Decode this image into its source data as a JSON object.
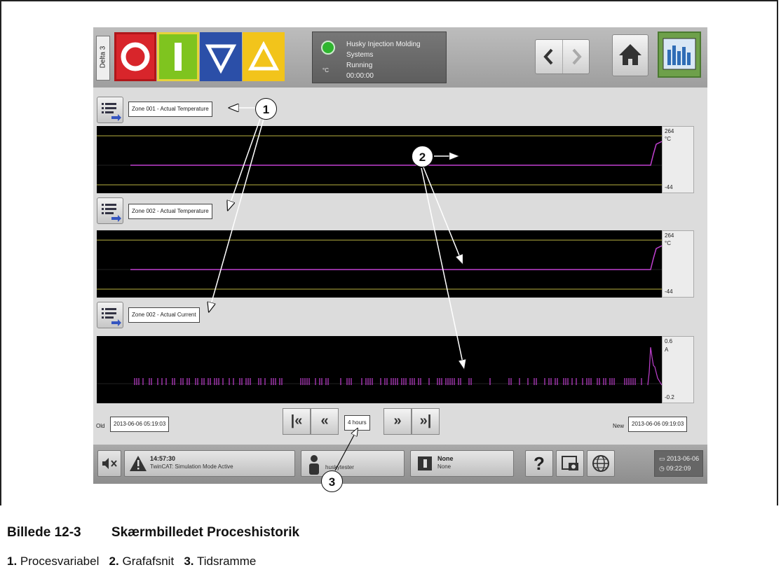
{
  "topbar": {
    "machine_label": "Delta 3",
    "status_title": "Husky Injection Molding Systems",
    "status_state": "Running",
    "status_time": "00:00:00",
    "status_unit": "°C",
    "status_light_color": "#2fb52f"
  },
  "rows": [
    {
      "label": "Zone 001 - Actual Temperature",
      "scale_max": "264",
      "scale_unit": "°C",
      "scale_min": "-44"
    },
    {
      "label": "Zone 002 - Actual Temperature",
      "scale_max": "264",
      "scale_unit": "°C",
      "scale_min": "-44"
    },
    {
      "label": "Zone 002 - Actual Current",
      "scale_max": "0.6",
      "scale_unit": "A",
      "scale_min": "-0.2"
    }
  ],
  "time_nav": {
    "old_label": "Old",
    "old_value": "2013-06-06 05:19:03",
    "range": "4 hours",
    "new_label": "New",
    "new_value": "2013-06-06 09:19:03"
  },
  "bottombar": {
    "alarm_time": "14:57:30",
    "alarm_text": "TwinCAT: Simulation Mode Active",
    "user": "huskytester",
    "mold_title": "None",
    "mold_sub": "None",
    "help": "?",
    "date": "2013-06-06",
    "time": "09:22:09"
  },
  "callouts": {
    "one": "1",
    "two": "2",
    "three": "3"
  },
  "caption": {
    "figure": "Billede 12-3",
    "title": "Skærmbilledet Proceshistorik"
  },
  "legend": [
    {
      "num": "1.",
      "text": "Procesvariabel"
    },
    {
      "num": "2.",
      "text": "Grafafsnit"
    },
    {
      "num": "3.",
      "text": "Tidsramme"
    }
  ],
  "colors": {
    "trace": "#c040d0",
    "limit_line": "#b8b240",
    "graph_bg": "#000000"
  }
}
